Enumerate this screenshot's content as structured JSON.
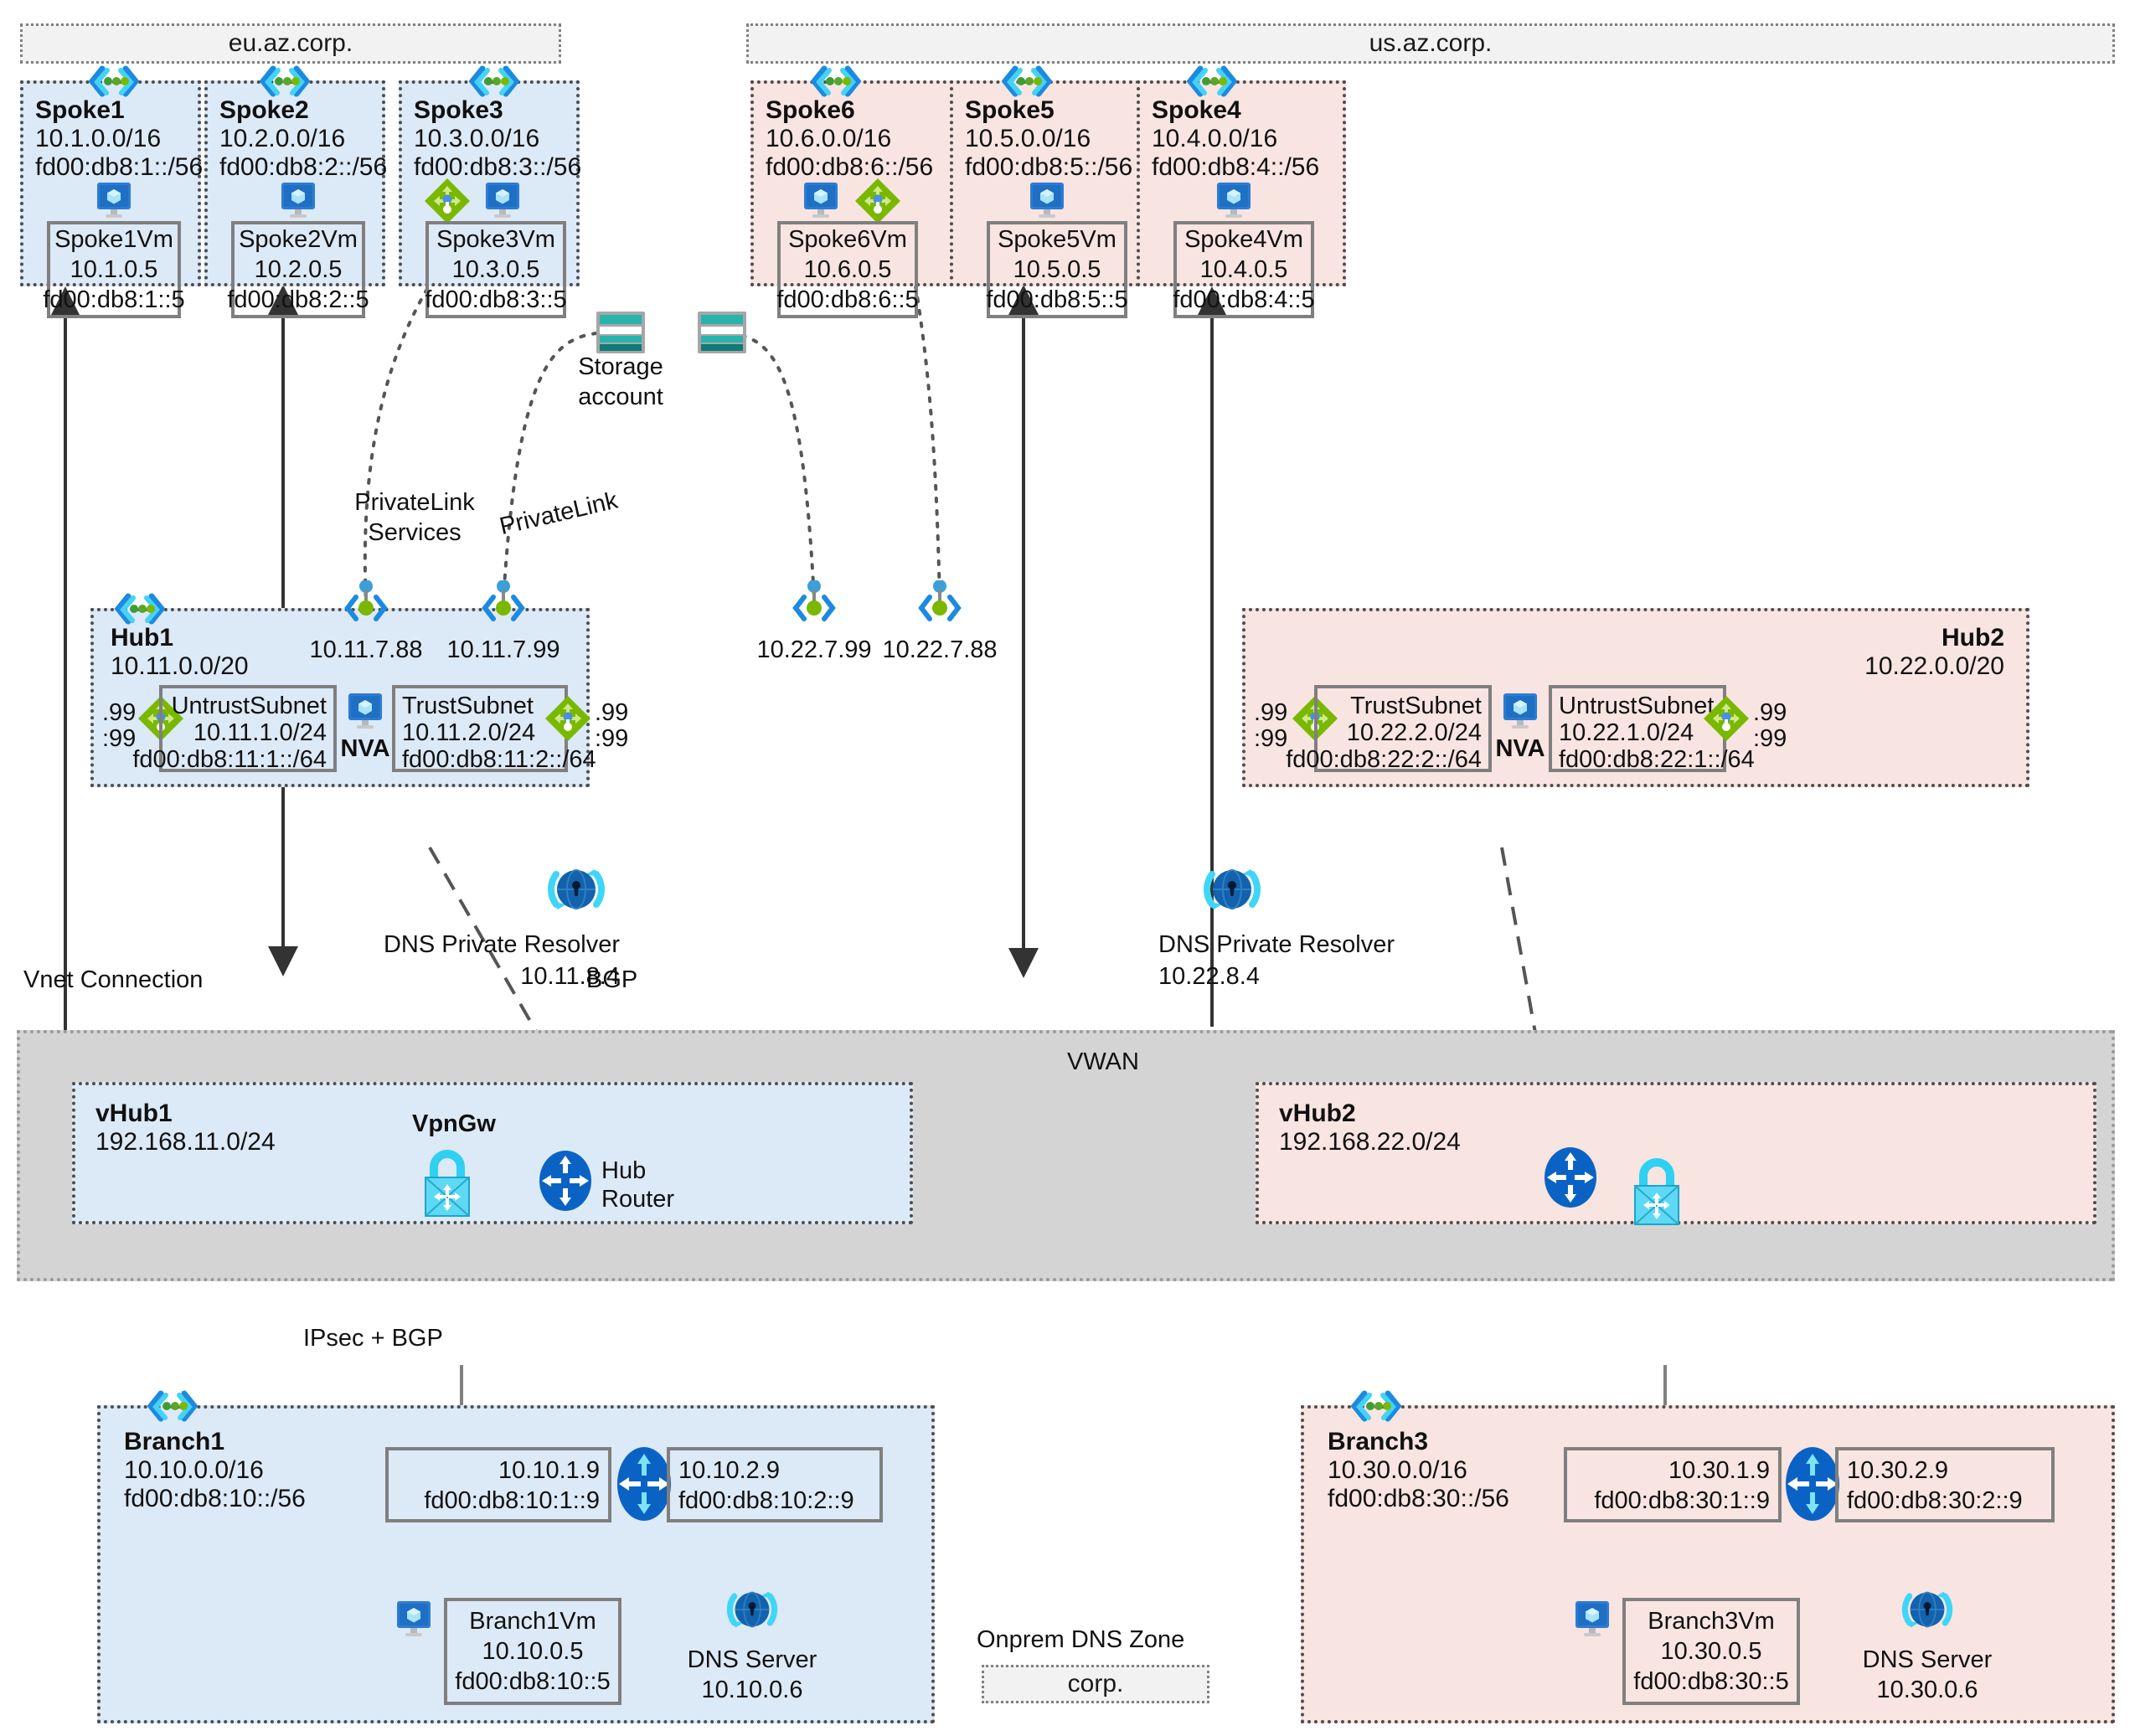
{
  "dns_zones": {
    "eu": "eu.az.corp.",
    "us": "us.az.corp.",
    "onprem_label": "Onprem DNS Zone",
    "onprem_zone": "corp."
  },
  "spokes": [
    {
      "name": "Spoke1",
      "cidr4": "10.1.0.0/16",
      "cidr6": "fd00:db8:1::/56",
      "vm": "Spoke1Vm",
      "vm4": "10.1.0.5",
      "vm6": "fd00:db8:1::5",
      "region": "eu",
      "has_router": false
    },
    {
      "name": "Spoke2",
      "cidr4": "10.2.0.0/16",
      "cidr6": "fd00:db8:2::/56",
      "vm": "Spoke2Vm",
      "vm4": "10.2.0.5",
      "vm6": "fd00:db8:2::5",
      "region": "eu",
      "has_router": false
    },
    {
      "name": "Spoke3",
      "cidr4": "10.3.0.0/16",
      "cidr6": "fd00:db8:3::/56",
      "vm": "Spoke3Vm",
      "vm4": "10.3.0.5",
      "vm6": "fd00:db8:3::5",
      "region": "eu",
      "has_router": true
    },
    {
      "name": "Spoke6",
      "cidr4": "10.6.0.0/16",
      "cidr6": "fd00:db8:6::/56",
      "vm": "Spoke6Vm",
      "vm4": "10.6.0.5",
      "vm6": "fd00:db8:6::5",
      "region": "us",
      "has_router": true
    },
    {
      "name": "Spoke5",
      "cidr4": "10.5.0.0/16",
      "cidr6": "fd00:db8:5::/56",
      "vm": "Spoke5Vm",
      "vm4": "10.5.0.5",
      "vm6": "fd00:db8:5::5",
      "region": "us",
      "has_router": false
    },
    {
      "name": "Spoke4",
      "cidr4": "10.4.0.0/16",
      "cidr6": "fd00:db8:4::/56",
      "vm": "Spoke4Vm",
      "vm4": "10.4.0.5",
      "vm6": "fd00:db8:4::5",
      "region": "us",
      "has_router": false
    }
  ],
  "hub1": {
    "name": "Hub1",
    "cidr": "10.11.0.0/20",
    "pe_pls": "10.11.7.88",
    "pe_storage": "10.11.7.99",
    "left_v4": ".99",
    "left_v6": ":99",
    "right_v4": ".99",
    "right_v6": ":99",
    "nva_label": "NVA",
    "subnets": [
      {
        "name": "UntrustSubnet",
        "cidr4": "10.11.1.0/24",
        "cidr6": "fd00:db8:11:1::/64"
      },
      {
        "name": "TrustSubnet",
        "cidr4": "10.11.2.0/24",
        "cidr6": "fd00:db8:11:2::/64"
      }
    ],
    "resolver_label": "DNS Private Resolver",
    "resolver_ip": "10.11.8.4"
  },
  "hub2": {
    "name": "Hub2",
    "cidr": "10.22.0.0/20",
    "pe_storage": "10.22.7.99",
    "pe_pls": "10.22.7.88",
    "left_v4": ".99",
    "left_v6": ":99",
    "right_v4": ".99",
    "right_v6": ":99",
    "nva_label": "NVA",
    "subnets": [
      {
        "name": "TrustSubnet",
        "cidr4": "10.22.2.0/24",
        "cidr6": "fd00:db8:22:2::/64"
      },
      {
        "name": "UntrustSubnet",
        "cidr4": "10.22.1.0/24",
        "cidr6": "fd00:db8:22:1::/64"
      }
    ],
    "resolver_label": "DNS Private Resolver",
    "resolver_ip": "10.22.8.4"
  },
  "vwan": {
    "label": "VWAN",
    "vhub1": {
      "name": "vHub1",
      "cidr": "192.168.11.0/24",
      "vpngw_label": "VpnGw",
      "router_line1": "Hub",
      "router_line2": "Router"
    },
    "vhub2": {
      "name": "vHub2",
      "cidr": "192.168.22.0/24"
    }
  },
  "branches": [
    {
      "name": "Branch1",
      "cidr4": "10.10.0.0/16",
      "cidr6": "fd00:db8:10::/56",
      "left4": "10.10.1.9",
      "left6": "fd00:db8:10:1::9",
      "right4": "10.10.2.9",
      "right6": "fd00:db8:10:2::9",
      "vm": "Branch1Vm",
      "vm4": "10.10.0.5",
      "vm6": "fd00:db8:10::5",
      "dns_label": "DNS Server",
      "dns_ip": "10.10.0.6"
    },
    {
      "name": "Branch3",
      "cidr4": "10.30.0.0/16",
      "cidr6": "fd00:db8:30::/56",
      "left4": "10.30.1.9",
      "left6": "fd00:db8:30:1::9",
      "right4": "10.30.2.9",
      "right6": "fd00:db8:30:2::9",
      "vm": "Branch3Vm",
      "vm4": "10.30.0.5",
      "vm6": "fd00:db8:30::5",
      "dns_label": "DNS Server",
      "dns_ip": "10.30.0.6"
    }
  ],
  "edge_labels": {
    "privatelink_services_l1": "PrivateLink",
    "privatelink_services_l2": "Services",
    "privatelink": "PrivateLink",
    "storage_l1": "Storage",
    "storage_l2": "account",
    "vnet_connection": "Vnet Connection",
    "bgp": "BGP",
    "ipsec_bgp": "IPsec + BGP"
  },
  "colors": {
    "blue_vnet": "#dce9f7",
    "pink_vnet": "#f8e4e1",
    "vwan_gray": "#d4d4d4",
    "zone_gray": "#f2f2f2",
    "border_gray": "#4d4d4d",
    "azure_blue": "#0078d4",
    "green": "#7ab800",
    "cyan": "#32c8f0"
  }
}
